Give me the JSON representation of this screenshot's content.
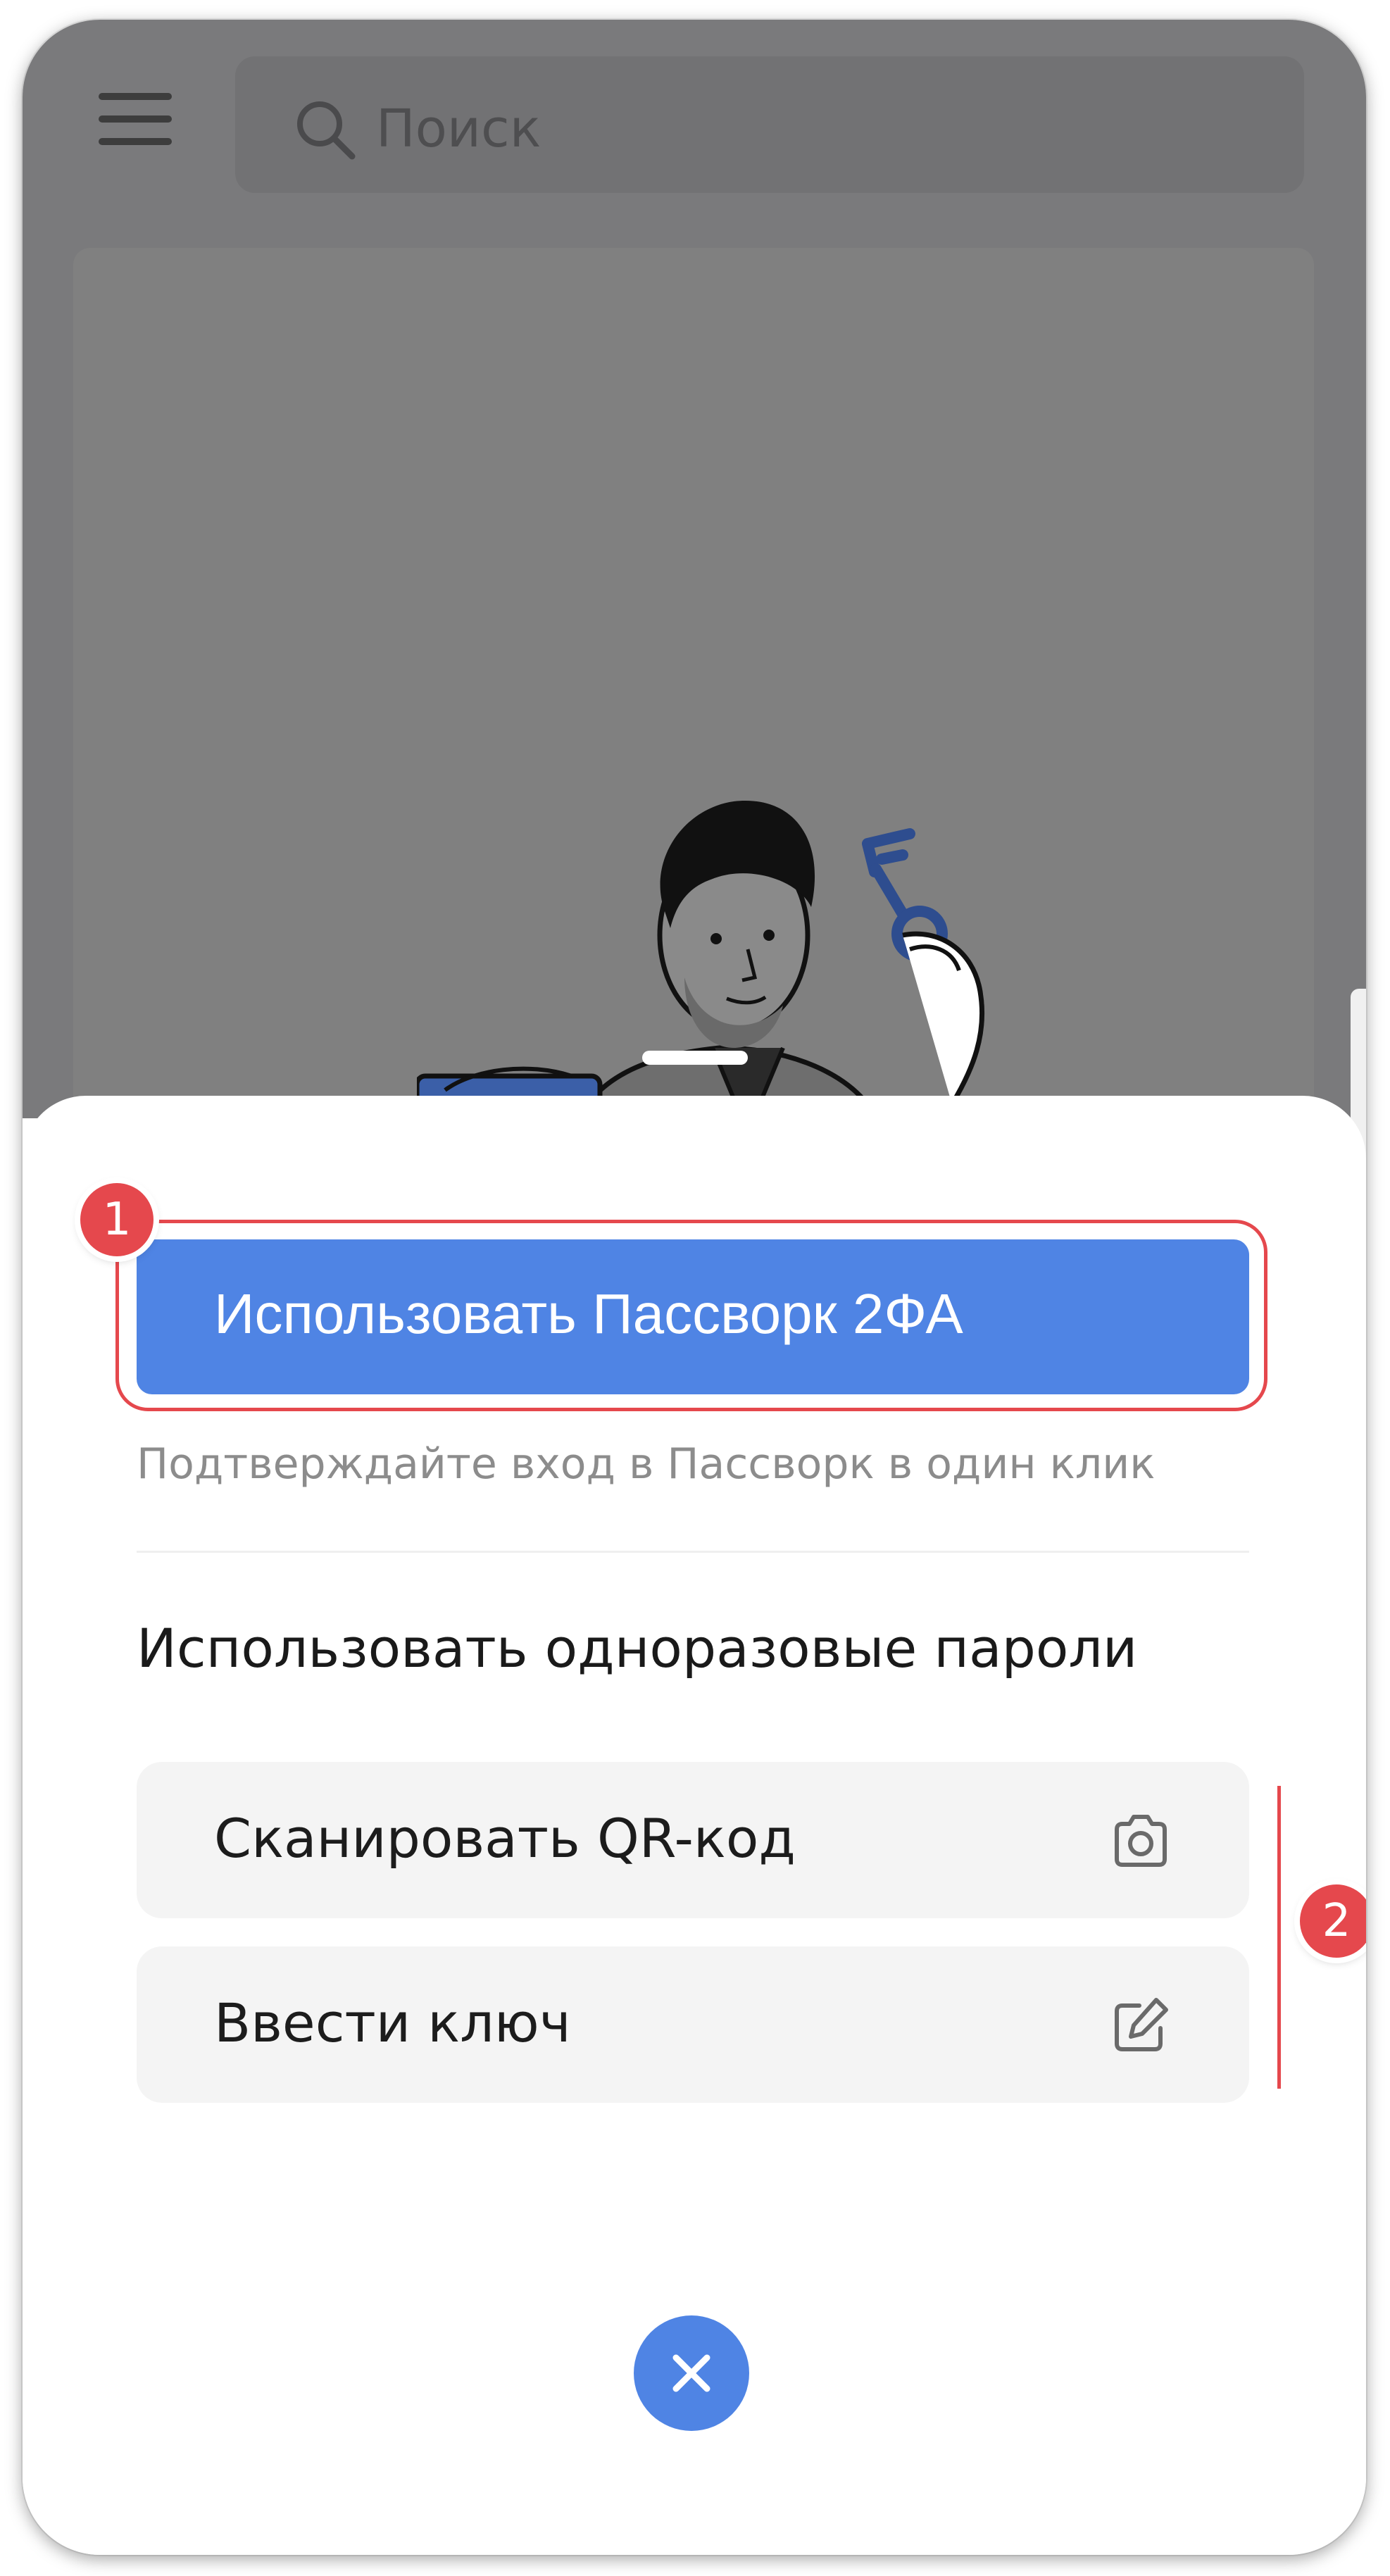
{
  "search": {
    "placeholder": "Поиск"
  },
  "sheet": {
    "primary_button_label": "Использовать Пассворк 2ФА",
    "primary_hint": "Подтверждайте вход в Пассворк в один клик",
    "section_title": "Использовать одноразовые пароли",
    "options": [
      {
        "label": "Сканировать QR-код",
        "icon": "camera-icon"
      },
      {
        "label": "Ввести ключ",
        "icon": "edit-icon"
      }
    ]
  },
  "annotations": {
    "badge_1": "1",
    "badge_2": "2"
  },
  "colors": {
    "accent": "#4f84e4",
    "annotation": "#e5484d",
    "overlay": "#7a7a7c",
    "option_background": "#f4f4f4"
  },
  "icons": [
    "menu-icon",
    "search-icon",
    "camera-icon",
    "edit-icon",
    "close-icon"
  ]
}
